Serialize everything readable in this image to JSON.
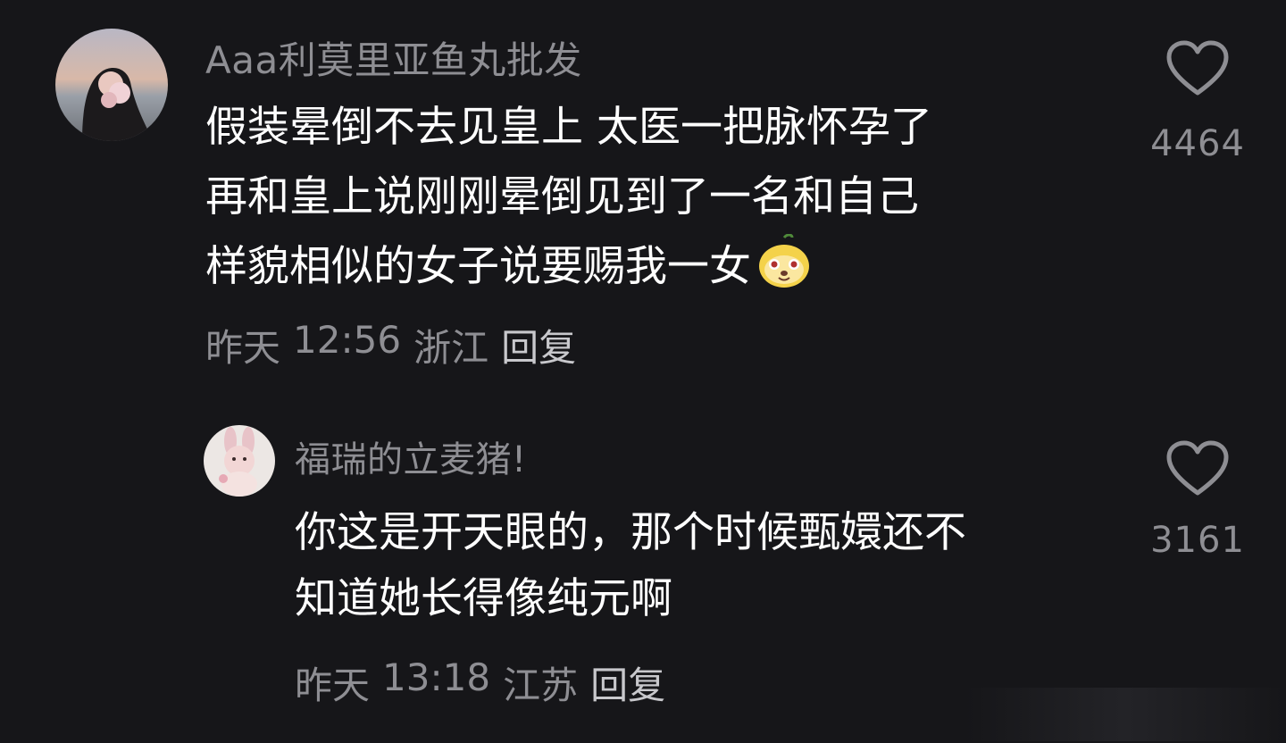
{
  "comments": [
    {
      "username": "Aaa利莫里亚鱼丸批发",
      "lines": [
        "假装晕倒不去见皇上 太医一把脉怀孕了",
        "再和皇上说刚刚晕倒见到了一名和自己",
        "样貌相似的女子说要赐我一女"
      ],
      "emoji": "smirk-face-emoji",
      "date": "昨天",
      "time": "12:56",
      "location": "浙江",
      "reply_label": "回复",
      "likes": "4464"
    },
    {
      "username": "福瑞的立麦猪!",
      "lines": [
        "你这是开天眼的，那个时候甄嬛还不",
        "知道她长得像纯元啊"
      ],
      "date": "昨天",
      "time": "13:18",
      "location": "江苏",
      "reply_label": "回复",
      "likes": "3161"
    }
  ],
  "colors": {
    "background": "#161619",
    "text": "#ffffff",
    "muted": "#8e8e93"
  }
}
